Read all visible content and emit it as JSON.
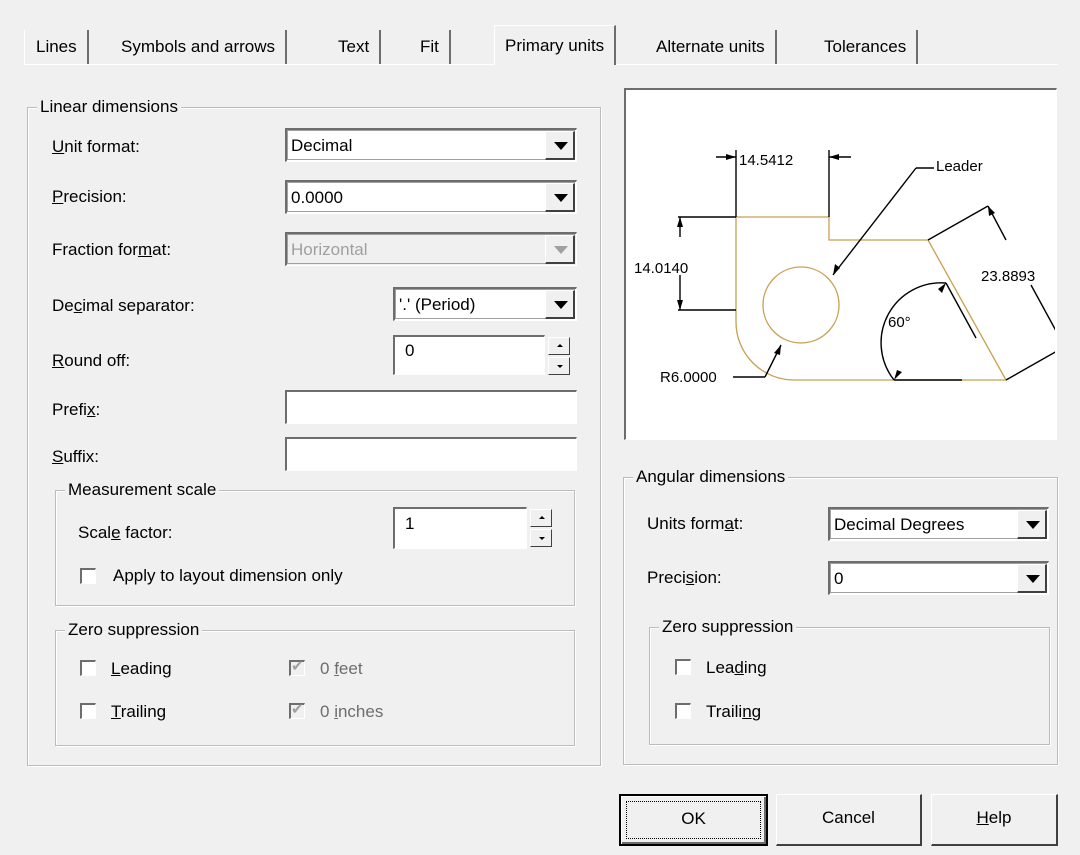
{
  "tabs": [
    {
      "label": "Lines",
      "active": false
    },
    {
      "label": "Symbols and arrows",
      "active": false
    },
    {
      "label": "Text",
      "active": false
    },
    {
      "label": "Fit",
      "active": false
    },
    {
      "label": "Primary units",
      "active": true
    },
    {
      "label": "Alternate units",
      "active": false
    },
    {
      "label": "Tolerances",
      "active": false
    }
  ],
  "linear": {
    "group_label": "Linear dimensions",
    "unit_format": {
      "label_pre": "",
      "label_ul": "U",
      "label_post": "nit format:",
      "value": "Decimal"
    },
    "precision": {
      "label_pre": "",
      "label_ul": "P",
      "label_post": "recision:",
      "value": "0.0000"
    },
    "fraction_format": {
      "label_pre": "Fraction for",
      "label_ul": "m",
      "label_post": "at:",
      "value": "Horizontal"
    },
    "decimal_separator": {
      "label_pre": "De",
      "label_ul": "c",
      "label_post": "imal separator:",
      "value": "'.' (Period)"
    },
    "round_off": {
      "label_pre": "",
      "label_ul": "R",
      "label_post": "ound off:",
      "value": "0"
    },
    "prefix": {
      "label_pre": "Prefi",
      "label_ul": "x",
      "label_post": ":",
      "value": ""
    },
    "suffix": {
      "label_pre": "",
      "label_ul": "S",
      "label_post": "uffix:",
      "value": ""
    },
    "measurement_scale": {
      "group_label": "Measurement scale",
      "scale_factor": {
        "label_pre": "Scal",
        "label_ul": "e",
        "label_post": " factor:",
        "value": "1"
      },
      "apply_layout": {
        "label": "Apply to layout dimension only",
        "checked": false
      }
    },
    "zero_suppression": {
      "group_label": "Zero suppression",
      "leading": {
        "label_pre": "",
        "label_ul": "L",
        "label_post": "eading",
        "checked": false
      },
      "trailing": {
        "label_pre": "",
        "label_ul": "T",
        "label_post": "railing",
        "checked": false
      },
      "feet": {
        "label_pre": "0 ",
        "label_ul": "f",
        "label_post": "eet",
        "checked": true
      },
      "inches": {
        "label_pre": "0 ",
        "label_ul": "i",
        "label_post": "nches",
        "checked": true
      }
    }
  },
  "preview": {
    "dim_top": "14.5412",
    "dim_left": "14.0140",
    "dim_right": "23.8893",
    "angle": "60°",
    "radius": "R6.0000",
    "leader": "Leader",
    "line_color": "#c8a050"
  },
  "angular": {
    "group_label": "Angular dimensions",
    "units_format": {
      "label_pre": "Units form",
      "label_ul": "a",
      "label_post": "t:",
      "value": "Decimal Degrees"
    },
    "precision": {
      "label_pre": "Preci",
      "label_ul": "s",
      "label_post": "ion:",
      "value": "0"
    },
    "zero_suppression": {
      "group_label": "Zero suppression",
      "leading": {
        "label_pre": "Lea",
        "label_ul": "d",
        "label_post": "ing",
        "checked": false
      },
      "trailing": {
        "label_pre": "Traili",
        "label_ul": "n",
        "label_post": "g",
        "checked": false
      }
    }
  },
  "buttons": {
    "ok": "OK",
    "cancel": "Cancel",
    "help_pre": "",
    "help_ul": "H",
    "help_post": "elp"
  }
}
